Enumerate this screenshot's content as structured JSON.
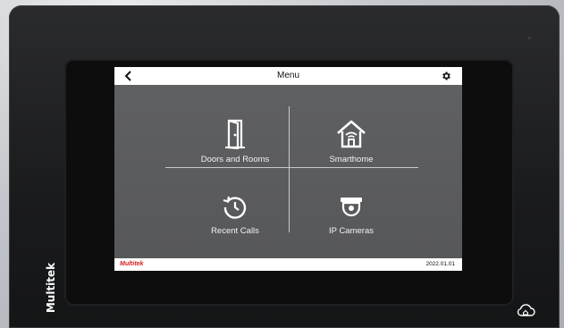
{
  "screen": {
    "title": "Menu",
    "brand": "Multitek",
    "date": "2022.01.01"
  },
  "tiles": [
    {
      "label": "Doors and Rooms",
      "icon": "door-icon"
    },
    {
      "label": "Smarthome",
      "icon": "smarthome-icon"
    },
    {
      "label": "Recent Calls",
      "icon": "recent-calls-icon"
    },
    {
      "label": "IP Cameras",
      "icon": "ip-camera-icon"
    }
  ],
  "device": {
    "logo": "Multitek",
    "icons": [
      "back-icon",
      "gear-icon",
      "cloud-home-icon"
    ]
  },
  "colors": {
    "screen_bg": "#5b5c5e",
    "bar_bg": "#ffffff",
    "brand_red": "#d31e1e",
    "device_body": "#1e1f21"
  }
}
